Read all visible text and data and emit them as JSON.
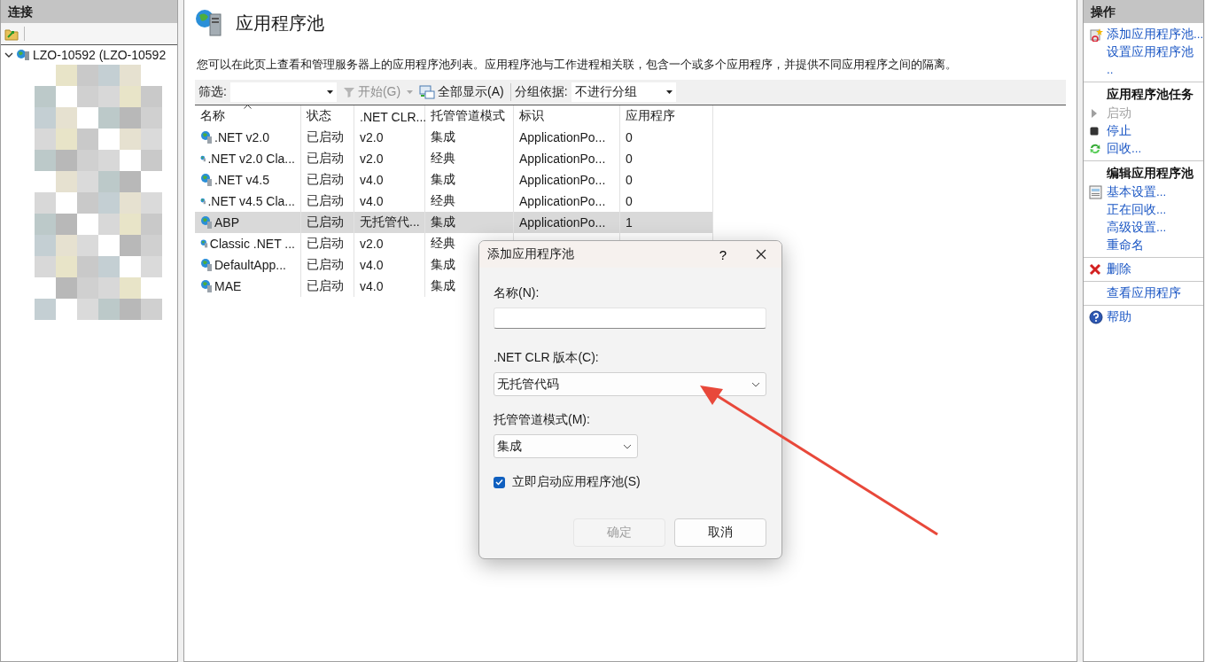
{
  "connections": {
    "title": "连接",
    "tree": [
      {
        "label": "LZO-10592 (LZO-10592",
        "expanded": true
      }
    ]
  },
  "main": {
    "title": "应用程序池",
    "description": "您可以在此页上查看和管理服务器上的应用程序池列表。应用程序池与工作进程相关联，包含一个或多个应用程序，并提供不同应用程序之间的隔离。",
    "toolbar": {
      "filter_label": "筛选:",
      "start": {
        "label": "开始(G)",
        "disabled": true
      },
      "show_all": "全部显示(A)",
      "group_label": "分组依据:",
      "group_value": "不进行分组"
    },
    "table": {
      "columns": [
        "名称",
        "状态",
        ".NET CLR...",
        "托管管道模式",
        "标识",
        "应用程序"
      ],
      "rows": [
        {
          "cells": [
            ".NET v2.0",
            "已启动",
            "v2.0",
            "集成",
            "ApplicationPo...",
            "0"
          ],
          "selected": false
        },
        {
          "cells": [
            ".NET v2.0 Cla...",
            "已启动",
            "v2.0",
            "经典",
            "ApplicationPo...",
            "0"
          ],
          "selected": false
        },
        {
          "cells": [
            ".NET v4.5",
            "已启动",
            "v4.0",
            "集成",
            "ApplicationPo...",
            "0"
          ],
          "selected": false
        },
        {
          "cells": [
            ".NET v4.5 Cla...",
            "已启动",
            "v4.0",
            "经典",
            "ApplicationPo...",
            "0"
          ],
          "selected": false
        },
        {
          "cells": [
            "ABP",
            "已启动",
            "无托管代...",
            "集成",
            "ApplicationPo...",
            "1"
          ],
          "selected": true
        },
        {
          "cells": [
            "Classic .NET ...",
            "已启动",
            "v2.0",
            "经典"
          ],
          "selected": false
        },
        {
          "cells": [
            "DefaultApp...",
            "已启动",
            "v4.0",
            "集成"
          ],
          "selected": false
        },
        {
          "cells": [
            "MAE",
            "已启动",
            "v4.0",
            "集成"
          ],
          "selected": false
        }
      ]
    }
  },
  "actions": {
    "title": "操作",
    "sections": [
      [
        {
          "kind": "link",
          "lines": [
            "添加应用程序池..."
          ],
          "disabled": false
        },
        {
          "kind": "link",
          "lines": [
            "设置应用程序池",
            ".."
          ],
          "disabled": false
        }
      ],
      [
        {
          "kind": "heading",
          "lines": [
            "应用程序池任务"
          ]
        },
        {
          "kind": "link",
          "lines": [
            "启动"
          ],
          "disabled": true
        },
        {
          "kind": "link",
          "lines": [
            "停止"
          ],
          "disabled": false
        },
        {
          "kind": "link",
          "lines": [
            "回收..."
          ],
          "disabled": false
        }
      ],
      [
        {
          "kind": "heading",
          "lines": [
            "编辑应用程序池"
          ]
        },
        {
          "kind": "link",
          "lines": [
            "基本设置..."
          ],
          "disabled": false
        },
        {
          "kind": "link",
          "lines": [
            "正在回收..."
          ],
          "disabled": false
        },
        {
          "kind": "link",
          "lines": [
            "高级设置..."
          ],
          "disabled": false
        },
        {
          "kind": "link",
          "lines": [
            "重命名"
          ],
          "disabled": false
        }
      ],
      [
        {
          "kind": "link",
          "lines": [
            "删除"
          ],
          "disabled": false
        }
      ],
      [
        {
          "kind": "link",
          "lines": [
            "查看应用程序"
          ],
          "disabled": false
        }
      ],
      [
        {
          "kind": "link",
          "lines": [
            "帮助"
          ],
          "disabled": false
        }
      ]
    ]
  },
  "dialog": {
    "title": "添加应用程序池",
    "help": "?",
    "name_label": "名称(N):",
    "clr_label": ".NET CLR 版本(C):",
    "clr_value": "无托管代码",
    "pipeline_label": "托管管道模式(M):",
    "pipeline_value": "集成",
    "start_now": {
      "label": "立即启动应用程序池(S)",
      "checked": true
    },
    "ok": {
      "label": "确定",
      "disabled": true
    },
    "cancel": {
      "label": "取消",
      "disabled": false
    }
  }
}
